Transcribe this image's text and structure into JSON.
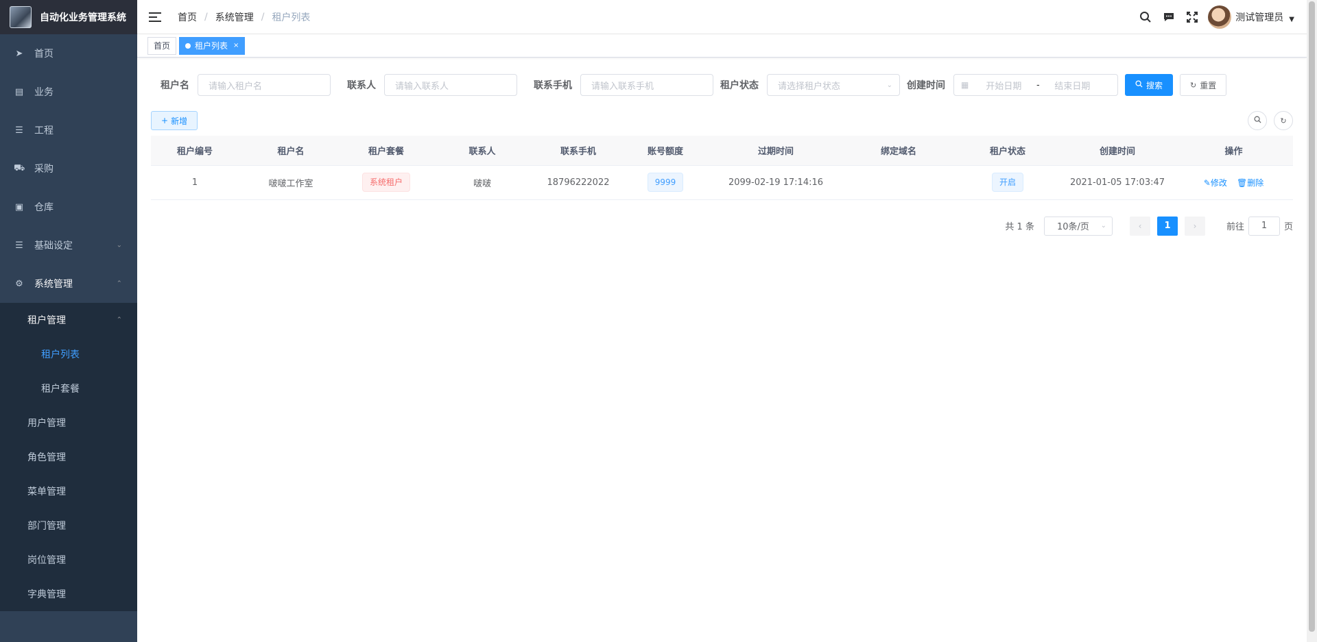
{
  "app": {
    "title": "自动化业务管理系统"
  },
  "sidebar": {
    "items": [
      {
        "label": "首页",
        "icon": "paper-plane-icon"
      },
      {
        "label": "业务",
        "icon": "document-icon"
      },
      {
        "label": "工程",
        "icon": "sliders-icon"
      },
      {
        "label": "采购",
        "icon": "cart-icon"
      },
      {
        "label": "仓库",
        "icon": "box-icon"
      },
      {
        "label": "基础设定",
        "icon": "sliders-icon"
      },
      {
        "label": "系统管理",
        "icon": "gear-icon"
      }
    ],
    "system_sub": {
      "tenant_group": "租户管理",
      "tenant_list": "租户列表",
      "tenant_package": "租户套餐",
      "others": [
        "用户管理",
        "角色管理",
        "菜单管理",
        "部门管理",
        "岗位管理",
        "字典管理"
      ]
    }
  },
  "navbar": {
    "breadcrumb": [
      "首页",
      "系统管理",
      "租户列表"
    ],
    "user_name": "测试管理员"
  },
  "tags": {
    "home": "首页",
    "active": "租户列表",
    "close": "×"
  },
  "search": {
    "tenant_name_label": "租户名",
    "tenant_name_placeholder": "请输入租户名",
    "contact_label": "联系人",
    "contact_placeholder": "请输入联系人",
    "phone_label": "联系手机",
    "phone_placeholder": "请输入联系手机",
    "status_label": "租户状态",
    "status_placeholder": "请选择租户状态",
    "created_label": "创建时间",
    "start_placeholder": "开始日期",
    "date_sep": "-",
    "end_placeholder": "结束日期",
    "search_btn": "搜索",
    "reset_btn": "重置"
  },
  "toolbar": {
    "add_btn": "新增"
  },
  "table": {
    "headers": [
      "租户编号",
      "租户名",
      "租户套餐",
      "联系人",
      "联系手机",
      "账号额度",
      "过期时间",
      "绑定域名",
      "租户状态",
      "创建时间",
      "操作"
    ],
    "rows": [
      {
        "id": "1",
        "name": "啵啵工作室",
        "package": "系统租户",
        "contact": "啵啵",
        "phone": "18796222022",
        "quota": "9999",
        "expire": "2099-02-19 17:14:16",
        "domain": "",
        "status": "开启",
        "created": "2021-01-05 17:03:47",
        "edit": "修改",
        "delete": "删除"
      }
    ]
  },
  "pagination": {
    "total": "共 1 条",
    "page_size": "10条/页",
    "current": "1",
    "goto_prefix": "前往",
    "goto_value": "1",
    "goto_suffix": "页"
  },
  "colors": {
    "primary": "#1890ff",
    "sidebar_bg": "#304156",
    "sidebar_sub_bg": "#1f2d3d",
    "active_menu": "#409eff"
  }
}
